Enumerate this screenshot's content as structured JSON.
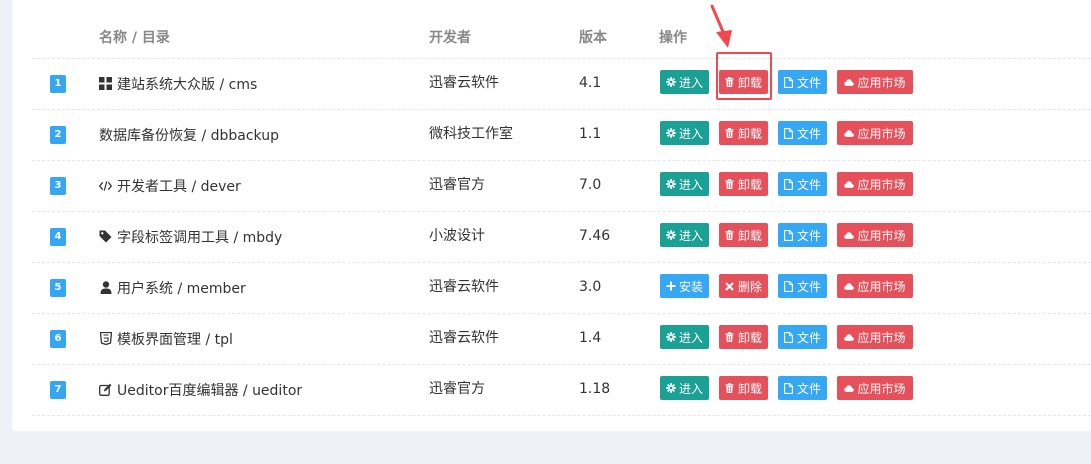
{
  "table": {
    "headers": {
      "name": "名称 / 目录",
      "developer": "开发者",
      "version": "版本",
      "actions": "操作"
    },
    "rows": [
      {
        "num": "1",
        "icon": "grid-icon",
        "name": "建站系统大众版 / cms",
        "developer": "迅睿云软件",
        "version": "4.1",
        "primary": "enter",
        "primary_label": "进入",
        "secondary": "uninstall",
        "secondary_label": "卸载"
      },
      {
        "num": "2",
        "icon": "",
        "name": "数据库备份恢复 / dbbackup",
        "developer": "微科技工作室",
        "version": "1.1",
        "primary": "enter",
        "primary_label": "进入",
        "secondary": "uninstall",
        "secondary_label": "卸载"
      },
      {
        "num": "3",
        "icon": "code-icon",
        "name": "开发者工具 / dever",
        "developer": "迅睿官方",
        "version": "7.0",
        "primary": "enter",
        "primary_label": "进入",
        "secondary": "uninstall",
        "secondary_label": "卸载"
      },
      {
        "num": "4",
        "icon": "tag-icon",
        "name": "字段标签调用工具 / mbdy",
        "developer": "小波设计",
        "version": "7.46",
        "primary": "enter",
        "primary_label": "进入",
        "secondary": "uninstall",
        "secondary_label": "卸载"
      },
      {
        "num": "5",
        "icon": "user-icon",
        "name": "用户系统 / member",
        "developer": "迅睿云软件",
        "version": "3.0",
        "primary": "install",
        "primary_label": "安装",
        "secondary": "delete",
        "secondary_label": "删除"
      },
      {
        "num": "6",
        "icon": "html5-icon",
        "name": "模板界面管理 / tpl",
        "developer": "迅睿云软件",
        "version": "1.4",
        "primary": "enter",
        "primary_label": "进入",
        "secondary": "uninstall",
        "secondary_label": "卸载"
      },
      {
        "num": "7",
        "icon": "edit-icon",
        "name": "Ueditor百度编辑器 / ueditor",
        "developer": "迅睿官方",
        "version": "1.18",
        "primary": "enter",
        "primary_label": "进入",
        "secondary": "uninstall",
        "secondary_label": "卸载"
      }
    ],
    "file_label": "文件",
    "market_label": "应用市场"
  },
  "colors": {
    "enter": "#1aa094",
    "install": "#36a7f3",
    "danger": "#e5505b",
    "info": "#36a7f3",
    "highlight": "#f04a4f"
  }
}
